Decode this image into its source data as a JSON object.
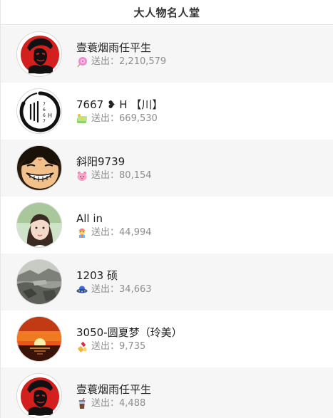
{
  "header": {
    "title": "大人物名人堂"
  },
  "entries": [
    {
      "name": "壹蓑烟雨任平生",
      "sent_label": "送出",
      "amount": "2,210,579",
      "avatar": "che-guevara-portrait",
      "gift_icon": "lollipop-icon"
    },
    {
      "name": "7667 ❥ H 【川】",
      "sent_label": "送出",
      "amount": "669,530",
      "avatar": "ink-circle-logo",
      "gift_icon": "money-stack-icon"
    },
    {
      "name": "斜阳9739",
      "sent_label": "送出",
      "amount": "80,154",
      "avatar": "anime-luffy-face",
      "gift_icon": "pink-bear-icon"
    },
    {
      "name": "All in",
      "sent_label": "送出",
      "amount": "44,994",
      "avatar": "girl-photo",
      "gift_icon": "colorful-doll-icon"
    },
    {
      "name": "1203 硕",
      "sent_label": "送出",
      "amount": "34,663",
      "avatar": "grey-landscape-photo",
      "gift_icon": "blue-ufo-icon"
    },
    {
      "name": "3050-圆夏梦（玲美）",
      "sent_label": "送出",
      "amount": "9,735",
      "avatar": "sunset-photo",
      "gift_icon": "lipstick-icon"
    },
    {
      "name": "壹蓑烟雨任平生",
      "sent_label": "送出",
      "amount": "4,488",
      "avatar": "che-guevara-portrait",
      "gift_icon": "drink-cup-icon"
    }
  ],
  "colors": {
    "header_text": "#333333",
    "name_text": "#222222",
    "sent_text": "#8d8d8d",
    "row_alt_bg": "#f6f6f6"
  }
}
